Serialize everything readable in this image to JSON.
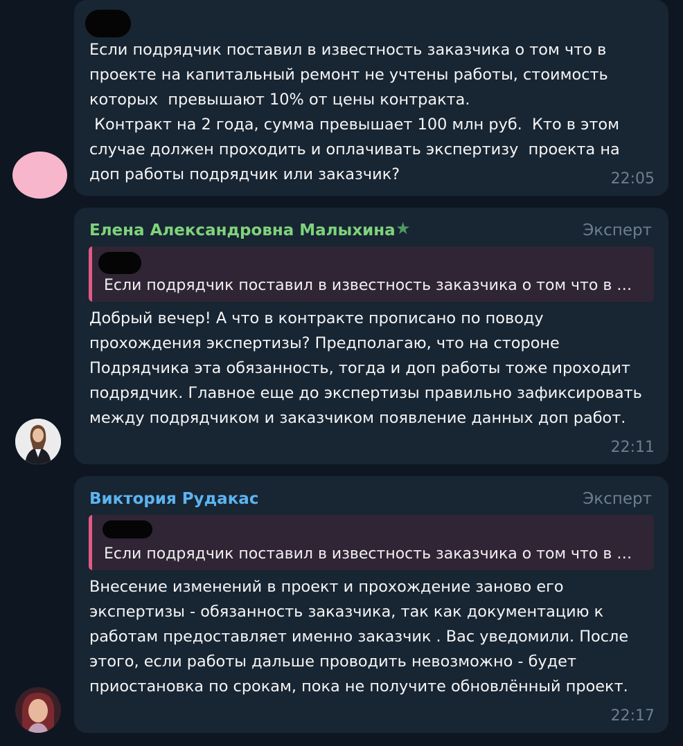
{
  "messages": [
    {
      "text": "Если подрядчик поставил в известность заказчика о том что в проекте на капитальный ремонт не учтены работы, стоимость которых  превышают 10% от цены контракта.\n Контракт на 2 года, сумма превышает 100 млн руб.  Кто в этом случае должен проходить и оплачивать экспертизу  проекта на доп работы подрядчик или заказчик?",
      "time": "22:05",
      "avatar_color": "#f7b6cb"
    },
    {
      "sender": "Елена Александровна Малыхина",
      "sender_color": "#7fd37a",
      "role": "Эксперт",
      "reply_text": "Если подрядчик поставил в известность заказчика о том что в проекте на капитальный ремонт не учтены работы",
      "text": "Добрый вечер! А что в контракте прописано по поводу прохождения экспертизы? Предполагаю, что на стороне Подрядчика эта обязанность, тогда и доп работы тоже проходит подрядчик. Главное еще до экспертизы правильно зафиксировать между подрядчиком и заказчиком появление данных доп работ.",
      "time": "22:11",
      "star_icon": "star-icon"
    },
    {
      "sender": "Виктория Рудакас",
      "sender_color": "#5cb4f0",
      "role": "Эксперт",
      "reply_text": "Если подрядчик поставил в известность заказчика о том что в проекте на капитальный ремонт не учтены работы",
      "text": "Внесение изменений в проект и прохождение заново его экспертизы - обязанность заказчика, так как документацию к работам предоставляет именно заказчик . Вас уведомили. После этого, если работы дальше проводить невозможно - будет приостановка по срокам, пока не получите обновлённый проект.",
      "time": "22:17"
    }
  ],
  "colors": {
    "background": "#0e1621",
    "bubble": "#182533",
    "reply_bar": "#e05a86",
    "reply_bg": "#2f2535",
    "meta_text": "#6d7f8f"
  }
}
